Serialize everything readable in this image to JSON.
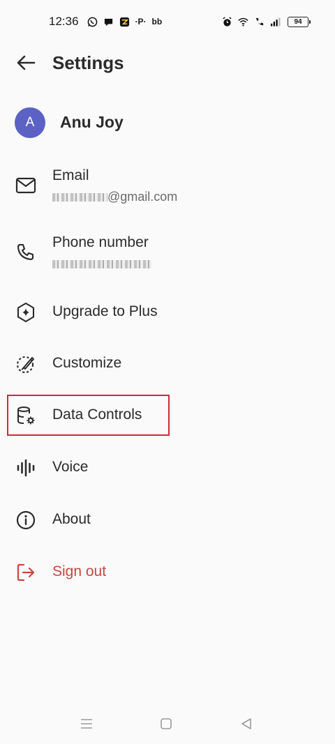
{
  "status_bar": {
    "time": "12:36",
    "battery": "94",
    "left_icons": [
      "whatsapp-icon",
      "chat-icon",
      "app-icon",
      "p-icon",
      "b-icon"
    ],
    "right_icons": [
      "alarm-icon",
      "wifi-icon",
      "call-icon",
      "signal-icon"
    ]
  },
  "header": {
    "title": "Settings",
    "back_icon": "arrow-left-icon"
  },
  "profile": {
    "initial": "A",
    "name": "Anu Joy",
    "avatar_color": "#5b62c4"
  },
  "menu": {
    "email": {
      "label": "Email",
      "value_suffix": "@gmail.com",
      "icon": "mail-icon"
    },
    "phone": {
      "label": "Phone number",
      "icon": "phone-icon"
    },
    "upgrade": {
      "label": "Upgrade to Plus",
      "icon": "sparkle-hexagon-icon"
    },
    "customize": {
      "label": "Customize",
      "icon": "brush-icon"
    },
    "data_controls": {
      "label": "Data Controls",
      "icon": "database-settings-icon"
    },
    "voice": {
      "label": "Voice",
      "icon": "audio-waveform-icon"
    },
    "about": {
      "label": "About",
      "icon": "info-icon"
    },
    "sign_out": {
      "label": "Sign out",
      "icon": "logout-icon",
      "color": "#c7473c"
    }
  },
  "highlight_color": "#d02a36",
  "nav_bar": {
    "icons": [
      "menu-icon",
      "home-icon",
      "back-icon"
    ]
  }
}
